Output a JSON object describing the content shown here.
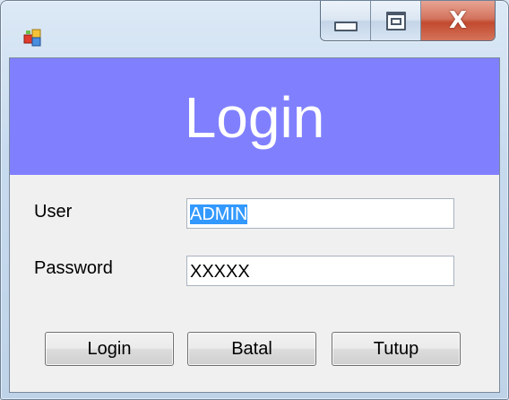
{
  "window": {
    "controls": {
      "minimize_icon": "minimize-icon",
      "maximize_icon": "maximize-icon",
      "close_glyph": "X"
    }
  },
  "header": {
    "title": "Login",
    "background": "#8080ff"
  },
  "form": {
    "user_label": "User",
    "user_value": "ADMIN",
    "password_label": "Password",
    "password_value": "XXXXX"
  },
  "buttons": {
    "login_label": "Login",
    "cancel_label": "Batal",
    "close_label": "Tutup"
  },
  "colors": {
    "selection": "#3399ff",
    "close_button": "#c24a2f"
  }
}
